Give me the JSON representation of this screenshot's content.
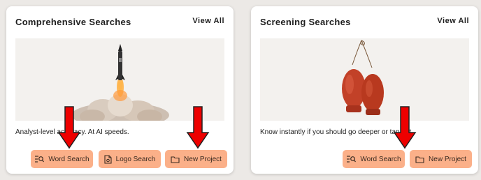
{
  "cards": [
    {
      "title": "Comprehensive Searches",
      "view_all": "View All",
      "tagline": "Analyst-level accuracy. At AI speeds.",
      "buttons": [
        {
          "label": "Word Search",
          "icon": "word-search-icon"
        },
        {
          "label": "Logo Search",
          "icon": "logo-document-icon"
        },
        {
          "label": "New Project",
          "icon": "folder-icon"
        }
      ]
    },
    {
      "title": "Screening Searches",
      "view_all": "View All",
      "tagline": "Know instantly if you should go deeper or tap out.",
      "buttons": [
        {
          "label": "Word Search",
          "icon": "word-search-icon"
        },
        {
          "label": "New Project",
          "icon": "folder-icon"
        }
      ]
    }
  ],
  "colors": {
    "button_bg": "#fbb089",
    "annotation_arrow": "#ee0000",
    "page_bg": "#ece9e6"
  }
}
